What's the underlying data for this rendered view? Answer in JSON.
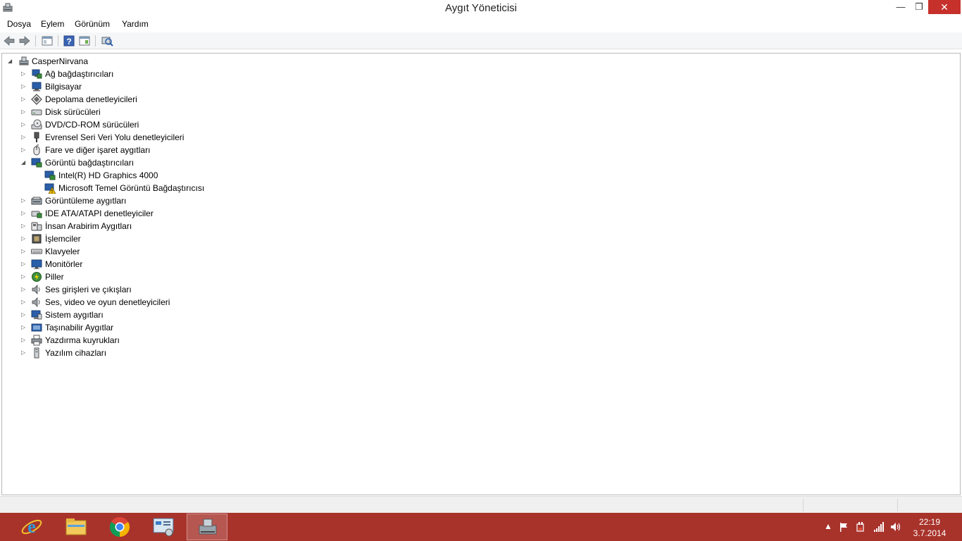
{
  "window": {
    "title": "Aygıt Yöneticisi",
    "minimize_label": "—",
    "maximize_label": "❐",
    "close_label": "✕"
  },
  "menu": {
    "items": [
      "Dosya",
      "Eylem",
      "Görünüm",
      "Yardım"
    ]
  },
  "toolbar": {
    "buttons": [
      "back-arrow-icon",
      "forward-arrow-icon",
      "console-tree-icon",
      "help-icon",
      "action-pane-icon",
      "scan-hardware-icon"
    ]
  },
  "tree": {
    "root": {
      "label": "CasperNirvana",
      "expanded": true
    },
    "items": [
      {
        "label": "Ağ bağdaştırıcıları",
        "icon": "network-adapter-icon",
        "expanded": false
      },
      {
        "label": "Bilgisayar",
        "icon": "computer-icon",
        "expanded": false
      },
      {
        "label": "Depolama denetleyicileri",
        "icon": "storage-controller-icon",
        "expanded": false
      },
      {
        "label": "Disk sürücüleri",
        "icon": "disk-drive-icon",
        "expanded": false
      },
      {
        "label": "DVD/CD-ROM sürücüleri",
        "icon": "dvd-drive-icon",
        "expanded": false
      },
      {
        "label": "Evrensel Seri Veri Yolu denetleyicileri",
        "icon": "usb-controller-icon",
        "expanded": false
      },
      {
        "label": "Fare ve diğer işaret aygıtları",
        "icon": "mouse-icon",
        "expanded": false
      },
      {
        "label": "Görüntü bağdaştırıcıları",
        "icon": "display-adapter-icon",
        "expanded": true,
        "children": [
          {
            "label": "Intel(R) HD Graphics 4000",
            "icon": "display-adapter-icon",
            "warning": false
          },
          {
            "label": "Microsoft Temel Görüntü Bağdaştırıcısı",
            "icon": "display-adapter-warning-icon",
            "warning": true
          }
        ]
      },
      {
        "label": "Görüntüleme aygıtları",
        "icon": "imaging-device-icon",
        "expanded": false
      },
      {
        "label": "IDE ATA/ATAPI denetleyiciler",
        "icon": "ide-controller-icon",
        "expanded": false
      },
      {
        "label": "İnsan Arabirim Aygıtları",
        "icon": "hid-icon",
        "expanded": false
      },
      {
        "label": "İşlemciler",
        "icon": "processor-icon",
        "expanded": false
      },
      {
        "label": "Klavyeler",
        "icon": "keyboard-icon",
        "expanded": false
      },
      {
        "label": "Monitörler",
        "icon": "monitor-icon",
        "expanded": false
      },
      {
        "label": "Piller",
        "icon": "battery-icon",
        "expanded": false
      },
      {
        "label": "Ses girişleri ve çıkışları",
        "icon": "audio-io-icon",
        "expanded": false
      },
      {
        "label": "Ses, video ve oyun denetleyicileri",
        "icon": "sound-controller-icon",
        "expanded": false
      },
      {
        "label": "Sistem aygıtları",
        "icon": "system-device-icon",
        "expanded": false
      },
      {
        "label": "Taşınabilir Aygıtlar",
        "icon": "portable-device-icon",
        "expanded": false
      },
      {
        "label": "Yazdırma kuyrukları",
        "icon": "print-queue-icon",
        "expanded": false
      },
      {
        "label": "Yazılım cihazları",
        "icon": "software-device-icon",
        "expanded": false
      }
    ]
  },
  "taskbar": {
    "apps": [
      "internet-explorer-icon",
      "file-explorer-icon",
      "chrome-icon",
      "control-panel-icon",
      "device-manager-icon"
    ],
    "active_app": "device-manager-icon",
    "tray_icons": [
      "show-hidden-icons-chevron",
      "action-center-flag-icon",
      "power-icon",
      "wifi-signal-icon",
      "volume-icon"
    ],
    "clock_time": "22:19",
    "clock_date": "3.7.2014"
  },
  "colors": {
    "taskbar": "#a8332b",
    "close_button": "#c7312b",
    "warning": "#f5c400"
  }
}
